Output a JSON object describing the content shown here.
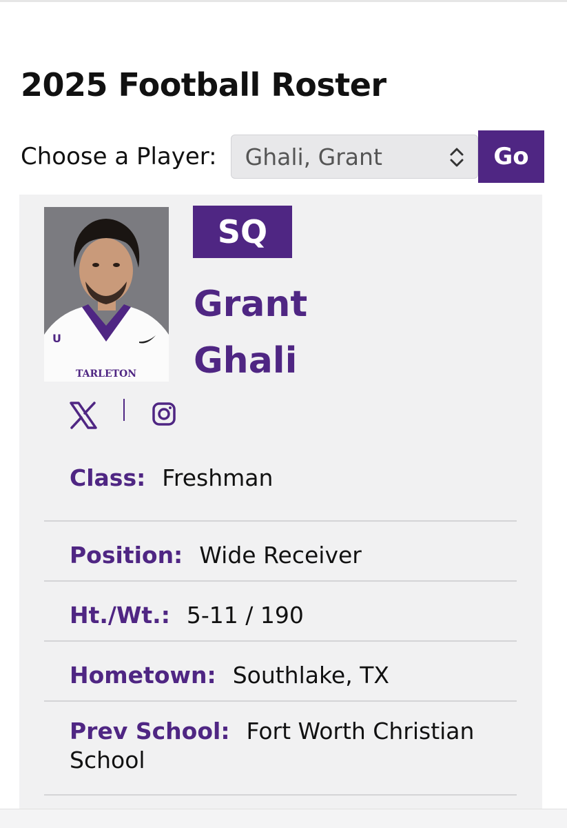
{
  "page": {
    "title": "2025 Football Roster"
  },
  "picker": {
    "label": "Choose a Player:",
    "selected": "Ghali, Grant",
    "go_label": "Go"
  },
  "player": {
    "jersey": "SQ",
    "first_name": "Grant",
    "last_name": "Ghali",
    "photo_jersey_text": "TARLETON",
    "social": [
      "x-icon",
      "instagram-icon"
    ]
  },
  "details": [
    {
      "label": "Class:",
      "value": "Freshman"
    },
    {
      "label": "Position:",
      "value": "Wide Receiver"
    },
    {
      "label": "Ht./Wt.:",
      "value": "5-11 / 190"
    },
    {
      "label": "Hometown:",
      "value": "Southlake, TX"
    },
    {
      "label": "Prev School:",
      "value": "Fort Worth Christian School"
    }
  ],
  "colors": {
    "accent": "#4f2683",
    "card_bg": "#f1f1f2",
    "text": "#111111"
  }
}
